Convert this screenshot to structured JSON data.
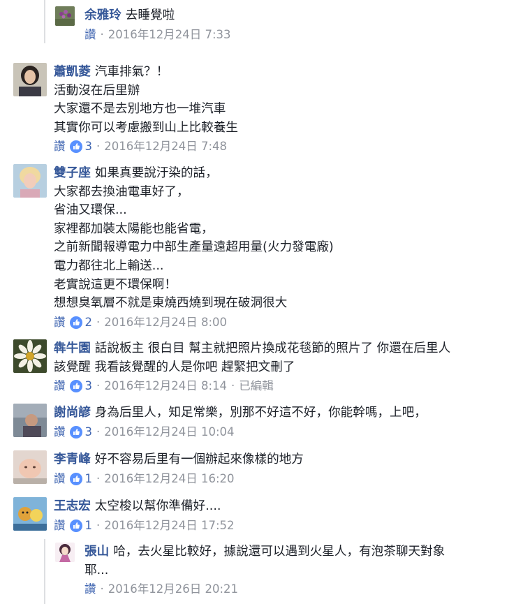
{
  "comments": [
    {
      "author": "余雅玲",
      "lines": [
        "去睡覺啦"
      ],
      "like_label": "讚",
      "likes": null,
      "time": "2016年12月24日 7:33",
      "edited": null,
      "reply": true
    },
    {
      "author": "蕭凱菱",
      "lines": [
        "汽車排氣？！",
        "活動沒在后里辦",
        "大家還不是去別地方也一堆汽車",
        "其實你可以考慮搬到山上比較養生"
      ],
      "like_label": "讚",
      "likes": "3",
      "time": "2016年12月24日 7:48",
      "edited": null,
      "reply": false
    },
    {
      "author": "雙子座",
      "lines": [
        "如果真要說汙染的話，",
        "大家都去換油電車好了，",
        "省油又環保...",
        "家裡都加裝太陽能也能省電，",
        "之前新聞報導電力中部生產量遠超用量(火力發電廠)",
        "電力都往北上輸送...",
        "老實說這更不環保啊！",
        "想想臭氧層不就是東燒西燒到現在破洞很大"
      ],
      "like_label": "讚",
      "likes": "2",
      "time": "2016年12月24日 8:00",
      "edited": null,
      "reply": false
    },
    {
      "author": "犇牛園",
      "lines": [
        "話說板主 很白目 幫主就把照片換成花毯節的照片了 你還在后里人",
        "該覺醒 我看該覺醒的人是你吧 趕緊把文刪了"
      ],
      "like_label": "讚",
      "likes": "3",
      "time": "2016年12月24日 8:14",
      "edited": "已編輯",
      "reply": false
    },
    {
      "author": "謝尚諺",
      "lines": [
        "身為后里人，知足常樂，別那不好這不好，你能幹嗎，上吧，"
      ],
      "like_label": "讚",
      "likes": "3",
      "time": "2016年12月24日 10:04",
      "edited": null,
      "reply": false
    },
    {
      "author": "李青峰",
      "lines": [
        "好不容易后里有一個辦起來像樣的地方"
      ],
      "like_label": "讚",
      "likes": "1",
      "time": "2016年12月24日 16:20",
      "edited": null,
      "reply": false
    },
    {
      "author": "王志宏",
      "lines": [
        "太空梭以幫你準備好...."
      ],
      "like_label": "讚",
      "likes": "1",
      "time": "2016年12月24日 17:52",
      "edited": null,
      "reply": false
    },
    {
      "author": "張山",
      "lines": [
        "哈，去火星比較好，據說還可以遇到火星人，有泡茶聊天對象",
        "耶..."
      ],
      "like_label": "讚",
      "likes": null,
      "time": "2016年12月26日 20:21",
      "edited": null,
      "reply": true
    }
  ],
  "colors": {
    "link": "#365899",
    "action": "#4267b2",
    "meta": "#90949c",
    "text": "#1d2129",
    "like_badge": "#5890ff"
  },
  "icons": {
    "like": "thumbs-up-icon"
  }
}
